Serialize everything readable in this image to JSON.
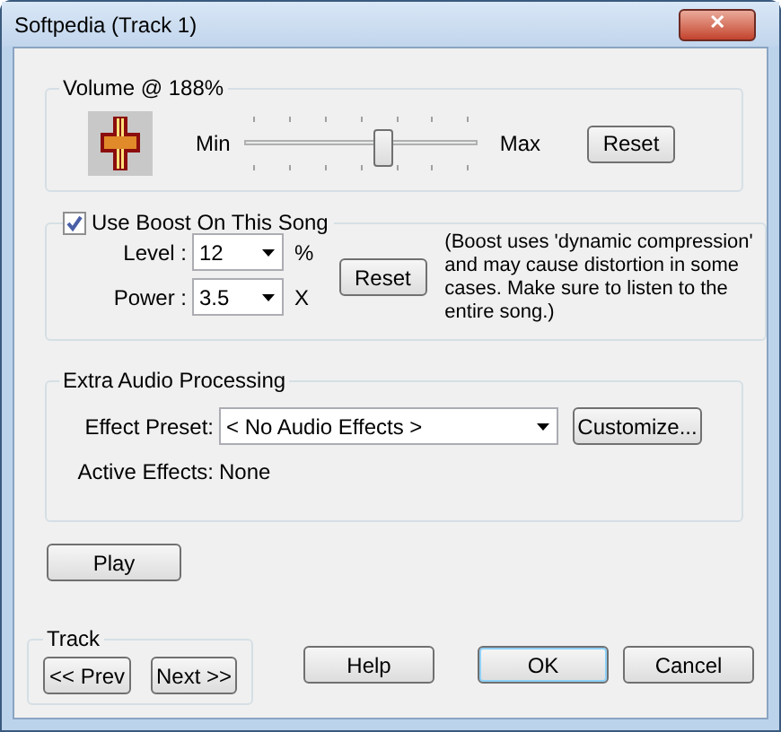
{
  "window": {
    "title": "Softpedia (Track 1)",
    "close": "✕"
  },
  "volume": {
    "title": "Volume @ 188%",
    "min_label": "Min",
    "max_label": "Max",
    "level": 0.6,
    "reset": "Reset"
  },
  "boost": {
    "label": "Use Boost On This Song",
    "checked": true,
    "level": {
      "label": "Level :",
      "value": "12",
      "unit": "%"
    },
    "power": {
      "label": "Power :",
      "value": "3.5",
      "unit": "X"
    },
    "reset": "Reset",
    "note": "(Boost uses 'dynamic compression' and may cause distortion in some cases.  Make sure to listen to the entire song.)"
  },
  "extra": {
    "title": "Extra Audio Processing",
    "preset_label": "Effect Preset:",
    "preset_value": "< No Audio Effects >",
    "customize": "Customize...",
    "active_label": "Active Effects:",
    "active_value": "None"
  },
  "play": "Play",
  "track": {
    "title": "Track",
    "prev": "<< Prev",
    "next": "Next >>"
  },
  "buttons": [
    {
      "label": "Help",
      "focused": false
    },
    {
      "label": "OK",
      "focused": true
    },
    {
      "label": "Cancel",
      "focused": false
    }
  ]
}
